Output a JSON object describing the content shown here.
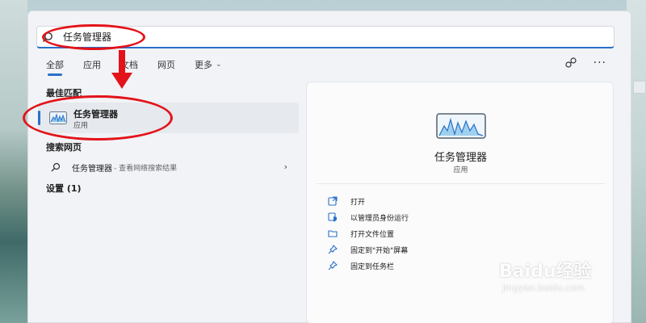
{
  "search": {
    "query": "任务管理器"
  },
  "tabs": [
    {
      "label": "全部"
    },
    {
      "label": "应用"
    },
    {
      "label": "文档"
    },
    {
      "label": "网页"
    },
    {
      "label": "更多"
    }
  ],
  "best_match": {
    "header": "最佳匹配",
    "title": "任务管理器",
    "subtitle": "应用"
  },
  "web_search": {
    "header": "搜索网页",
    "query": "任务管理器",
    "suffix": "- 查看网络搜索结果"
  },
  "settings": {
    "header": "设置 (1)"
  },
  "detail": {
    "title": "任务管理器",
    "subtitle": "应用",
    "actions": [
      {
        "label": "打开",
        "icon": "open-external-icon"
      },
      {
        "label": "以管理员身份运行",
        "icon": "shield-icon"
      },
      {
        "label": "打开文件位置",
        "icon": "folder-icon"
      },
      {
        "label": "固定到\"开始\"屏幕",
        "icon": "pin-icon"
      },
      {
        "label": "固定到任务栏",
        "icon": "pin-icon"
      }
    ]
  },
  "watermark": {
    "main": "Baidu经验",
    "sub": "jingyan.baidu.com"
  },
  "colors": {
    "accent": "#2a70c9",
    "annotation": "#e3131a"
  }
}
